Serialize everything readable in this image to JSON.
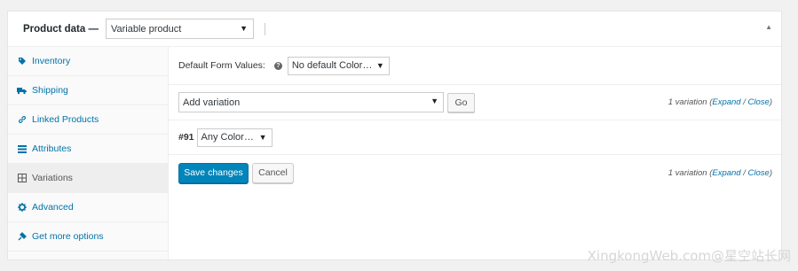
{
  "header": {
    "title": "Product data —",
    "product_type": "Variable product"
  },
  "sidebar": {
    "items": [
      {
        "label": "Inventory",
        "icon": "tag-icon"
      },
      {
        "label": "Shipping",
        "icon": "truck-icon"
      },
      {
        "label": "Linked Products",
        "icon": "link-icon"
      },
      {
        "label": "Attributes",
        "icon": "list-icon"
      },
      {
        "label": "Variations",
        "icon": "grid-icon",
        "active": true
      },
      {
        "label": "Advanced",
        "icon": "gear-icon"
      },
      {
        "label": "Get more options",
        "icon": "plugin-icon"
      }
    ]
  },
  "main": {
    "defaults_label": "Default Form Values:",
    "default_color_value": "No default Color…",
    "add_variation_value": "Add variation",
    "go_label": "Go",
    "variation_count_text": "1 variation (",
    "expand_label": "Expand",
    "separator": " / ",
    "close_label": "Close",
    "close_paren": ")",
    "variation_id": "#91",
    "variation_color_value": "Any Color…",
    "save_label": "Save changes",
    "cancel_label": "Cancel"
  },
  "watermark": "XingkongWeb.com@星空站长网",
  "colors": {
    "accent": "#0073aa",
    "primary_button": "#0085ba"
  }
}
